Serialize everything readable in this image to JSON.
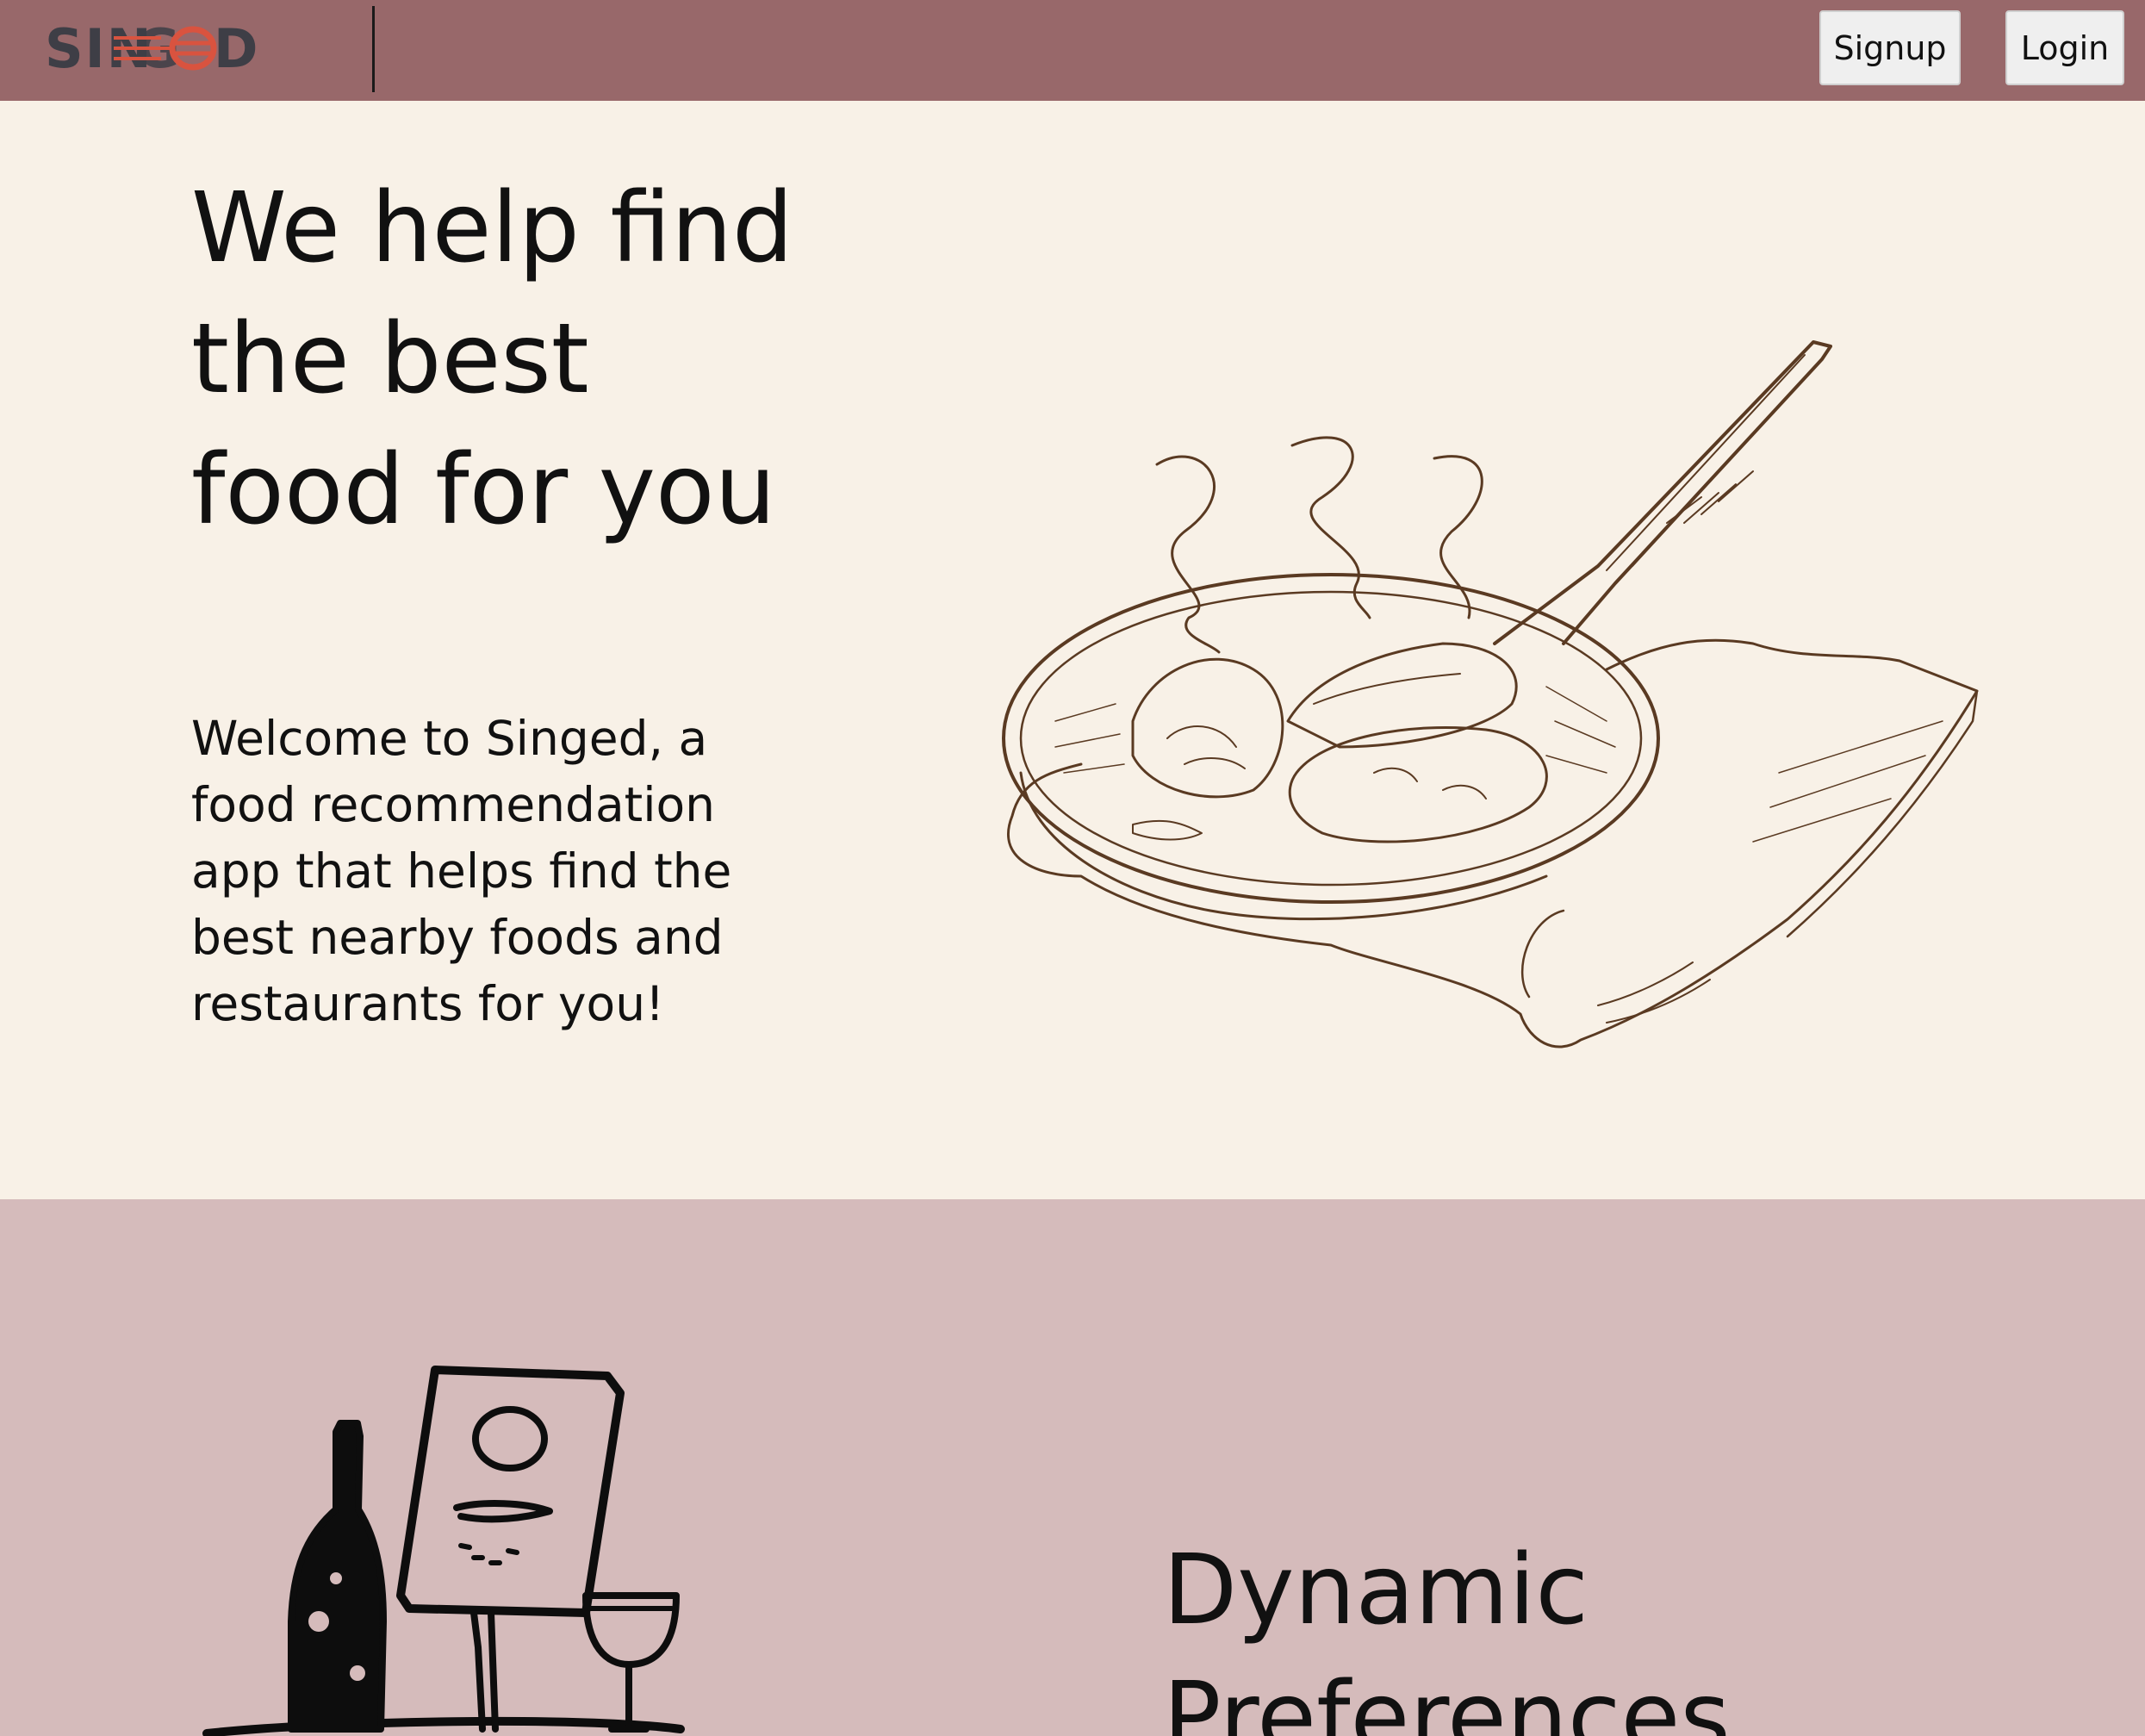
{
  "navbar": {
    "logo_text": "SINGED",
    "signup_label": "Signup",
    "login_label": "Login"
  },
  "hero": {
    "title": "We help find the best food for you",
    "description": "Welcome to Singed, a food recommendation app that helps find the best nearby foods and restaurants for you!"
  },
  "features": {
    "title": "Dynamic Preferences"
  },
  "colors": {
    "navbar": "#98686a",
    "hero_bg": "#f8f1e7",
    "features_bg": "#d5bbbb",
    "sketch": "#5a3a22",
    "logo_text": "#3e3e46",
    "logo_accent": "#d9533f"
  },
  "icons": {
    "logo": "singed-logo-icon",
    "hero_image": "frying-pan-illustration",
    "features_image": "menu-wine-illustration"
  }
}
